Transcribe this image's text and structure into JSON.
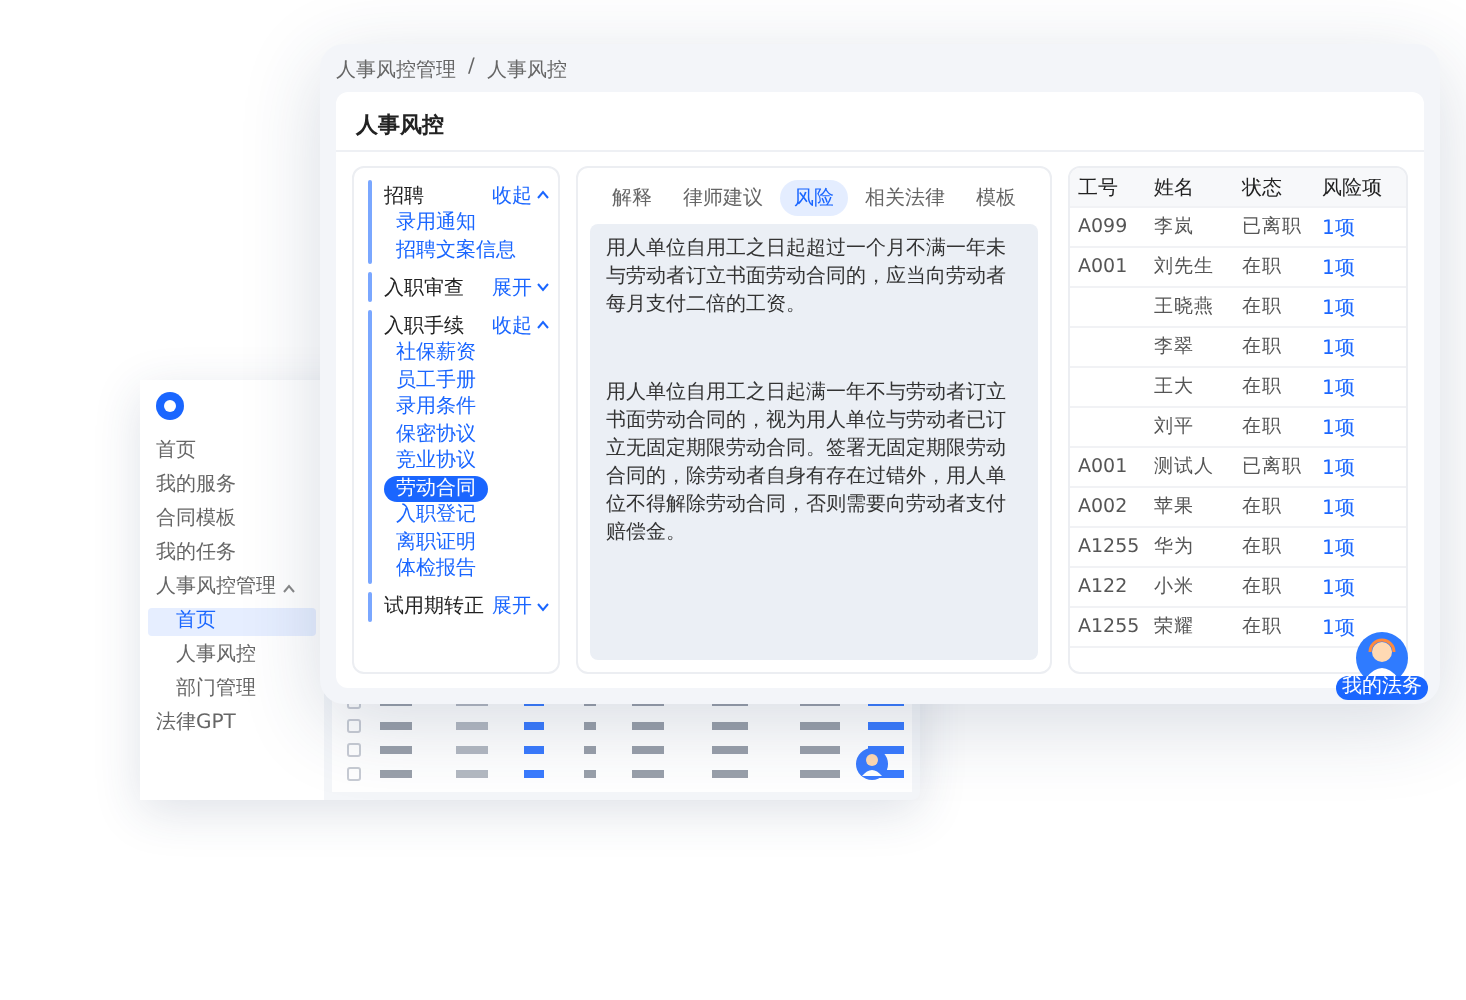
{
  "back_window": {
    "sidebar": {
      "items": [
        {
          "label": "首页",
          "selected": false
        },
        {
          "label": "我的服务",
          "selected": false
        },
        {
          "label": "合同模板",
          "selected": false
        },
        {
          "label": "我的任务",
          "selected": false
        },
        {
          "label": "人事风控管理",
          "selected": false,
          "expanded": true,
          "children": [
            {
              "label": "首页",
              "selected": true
            },
            {
              "label": "人事风控",
              "selected": false
            },
            {
              "label": "部门管理",
              "selected": false
            }
          ]
        },
        {
          "label": "法律GPT",
          "selected": false
        }
      ]
    }
  },
  "window": {
    "breadcrumb": [
      "人事风控管理",
      "人事风控"
    ],
    "breadcrumb_separator": "/",
    "title": "人事风控"
  },
  "tree": [
    {
      "label": "招聘",
      "toggle": "收起",
      "expanded": true,
      "children": [
        {
          "label": "录用通知",
          "selected": false
        },
        {
          "label": "招聘文案信息",
          "selected": false
        }
      ]
    },
    {
      "label": "入职审查",
      "toggle": "展开",
      "expanded": false
    },
    {
      "label": "入职手续",
      "toggle": "收起",
      "expanded": true,
      "children": [
        {
          "label": "社保薪资",
          "selected": false
        },
        {
          "label": "员工手册",
          "selected": false
        },
        {
          "label": "录用条件",
          "selected": false
        },
        {
          "label": "保密协议",
          "selected": false
        },
        {
          "label": "竞业协议",
          "selected": false
        },
        {
          "label": "劳动合同",
          "selected": true
        },
        {
          "label": "入职登记",
          "selected": false
        },
        {
          "label": "离职证明",
          "selected": false
        },
        {
          "label": "体检报告",
          "selected": false
        }
      ]
    },
    {
      "label": "试用期转正",
      "toggle": "展开",
      "expanded": false
    }
  ],
  "tabs": [
    {
      "label": "解释",
      "selected": false
    },
    {
      "label": "律师建议",
      "selected": false
    },
    {
      "label": "风险",
      "selected": true
    },
    {
      "label": "相关法律",
      "selected": false
    },
    {
      "label": "模板",
      "selected": false
    }
  ],
  "paragraphs": [
    "用人单位自用工之日起超过一个月不满一年未与劳动者订立书面劳动合同的，应当向劳动者每月支付二倍的工资。",
    "用人单位自用工之日起满一年不与劳动者订立书面劳动合同的，视为用人单位与劳动者已订立无固定期限劳动合同。签署无固定期限劳动合同的，除劳动者自身有存在过错外，用人单位不得解除劳动合同，否则需要向劳动者支付赔偿金。"
  ],
  "table": {
    "columns": [
      "工号",
      "姓名",
      "状态",
      "风险项"
    ],
    "rows": [
      {
        "id": "A099",
        "name": "李岚",
        "status": "已离职",
        "risk": "1项"
      },
      {
        "id": "A001",
        "name": "刘先生",
        "status": "在职",
        "risk": "1项"
      },
      {
        "name": "王晓燕",
        "status": "在职",
        "risk": "1项"
      },
      {
        "name": "李翠",
        "status": "在职",
        "risk": "1项"
      },
      {
        "name": "王大",
        "status": "在职",
        "risk": "1项"
      },
      {
        "name": "刘平",
        "status": "在职",
        "risk": "1项"
      },
      {
        "id": "A001",
        "name": "测试人",
        "status": "已离职",
        "risk": "1项"
      },
      {
        "id": "A002",
        "name": "苹果",
        "status": "在职",
        "risk": "1项"
      },
      {
        "id": "A1255",
        "name": "华为",
        "status": "在职",
        "risk": "1项"
      },
      {
        "id": "A122",
        "name": "小米",
        "status": "在职",
        "risk": "1项"
      },
      {
        "id": "A1255",
        "name": "荣耀",
        "status": "在职",
        "risk": "1项"
      }
    ]
  },
  "assistant": {
    "label": "我的法务"
  }
}
